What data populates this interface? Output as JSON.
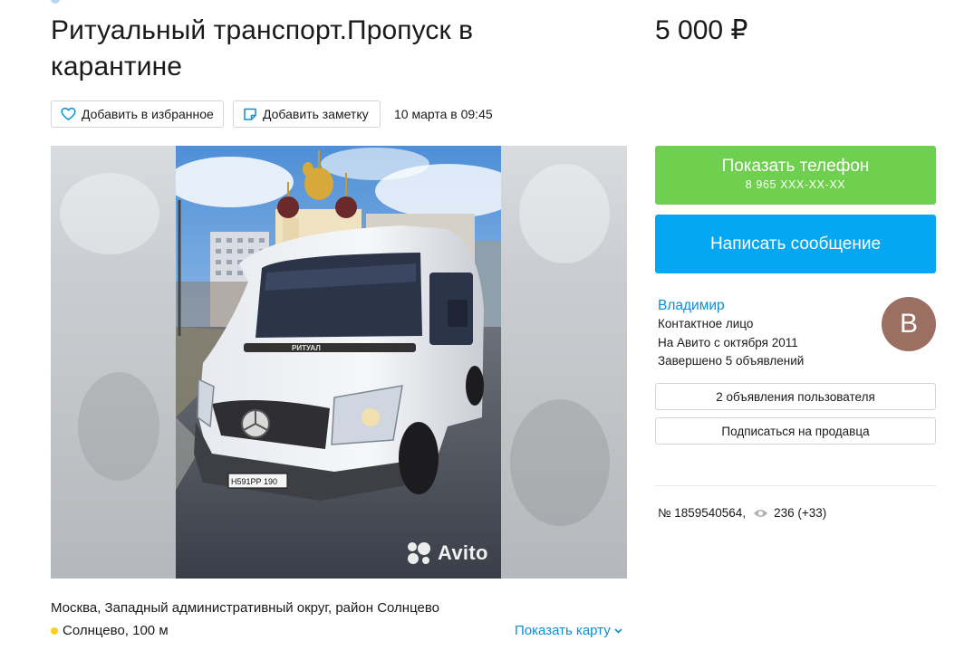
{
  "listing": {
    "title": "Ритуальный транспорт.Пропуск в карантине",
    "price": "5 000 ₽",
    "posted_date": "10 марта в 09:45",
    "actions": {
      "favorite_label": "Добавить в избранное",
      "note_label": "Добавить заметку"
    },
    "photo": {
      "watermark_text": "Avito",
      "plate_text": "Н591РР 190",
      "hood_text": "РИТУАЛ"
    }
  },
  "contact": {
    "phone_label": "Показать телефон",
    "phone_masked": "8 965 XXX-XX-XX",
    "message_label": "Написать сообщение"
  },
  "seller": {
    "name": "Владимир",
    "role": "Контактное лицо",
    "since": "На Авито с октября 2011",
    "completed": "Завершено 5 объявлений",
    "avatar_letter": "В",
    "listings_button": "2 объявления пользователя",
    "subscribe_button": "Подписаться на продавца"
  },
  "stats": {
    "listing_number": "№ 1859540564,",
    "views": "236 (+33)"
  },
  "location": {
    "address": "Москва, Западный административный округ, район Солнцево",
    "metro": "Солнцево, 100 м",
    "show_map_label": "Показать карту"
  },
  "colors": {
    "phone_button": "#6fd04f",
    "message_button": "#05a6f2",
    "link": "#0a8fd6",
    "avatar": "#9b6f61",
    "metro_dot": "#ffcd1c"
  }
}
